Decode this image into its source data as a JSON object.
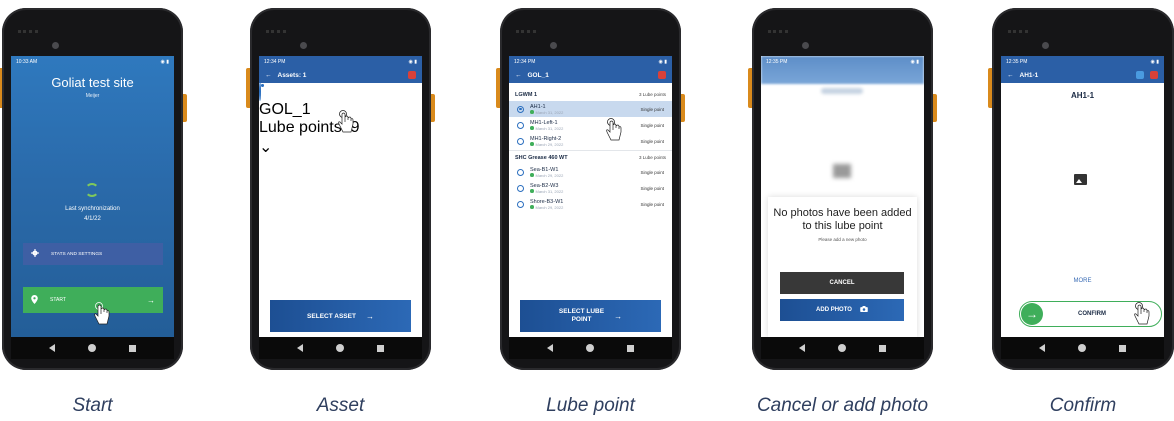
{
  "phones": [
    {
      "caption": "Start",
      "status_time": "10:33 AM",
      "site_title": "Goliat test site",
      "site_sub": "Meijer",
      "sync_label": "Last synchronization",
      "sync_date": "4/1/22",
      "stats_button": "STATS AND SETTINGS",
      "start_button": "START"
    },
    {
      "caption": "Asset",
      "status_time": "12:34 PM",
      "app_title": "Assets: 1",
      "asset_name": "GOL_1",
      "asset_sub": "Lube points: 9",
      "select_button": "SELECT ASSET"
    },
    {
      "caption": "Lube point",
      "status_time": "12:34 PM",
      "app_title": "GOL_1",
      "groups": [
        {
          "name": "LGWM 1",
          "count": "3 Lube points",
          "points": [
            {
              "name": "AH1-1",
              "date": "March 31, 2022",
              "type": "Single point",
              "selected": true
            },
            {
              "name": "MH1-Left-1",
              "date": "March 31, 2022",
              "type": "Single point",
              "selected": false
            },
            {
              "name": "MH1-Right-2",
              "date": "March 29, 2022",
              "type": "Single point",
              "selected": false
            }
          ]
        },
        {
          "name": "SHC Grease 460 WT",
          "count": "3 Lube points",
          "points": [
            {
              "name": "Sea-B1-W1",
              "date": "March 29, 2022",
              "type": "Single point",
              "selected": false
            },
            {
              "name": "Sea-B2-W3",
              "date": "March 31, 2022",
              "type": "Single point",
              "selected": false
            },
            {
              "name": "Shore-B3-W1",
              "date": "March 29, 2022",
              "type": "Single point",
              "selected": false
            }
          ]
        }
      ],
      "select_button_line1": "SELECT LUBE",
      "select_button_line2": "POINT"
    },
    {
      "caption": "Cancel or add photo",
      "status_time": "12:35 PM",
      "message": "No photos have been added to this lube point",
      "hint": "Please add a new photo",
      "cancel_button": "CANCEL",
      "add_button": "ADD PHOTO"
    },
    {
      "caption": "Confirm",
      "status_time": "12:35 PM",
      "app_title": "AH1-1",
      "lp_title": "AH1-1",
      "more_link": "MORE",
      "confirm_button": "CONFIRM"
    }
  ],
  "colors": {
    "brand_blue": "#2b5fa6",
    "start_green": "#3fae5a",
    "stats_blue": "#3e5fa4",
    "alert_red": "#d9413a"
  },
  "icons": [
    "back-arrow-icon",
    "gear-icon",
    "location-pin-icon",
    "arrow-right-icon",
    "sync-icon",
    "camera-icon",
    "image-icon",
    "tap-hand-icon"
  ]
}
